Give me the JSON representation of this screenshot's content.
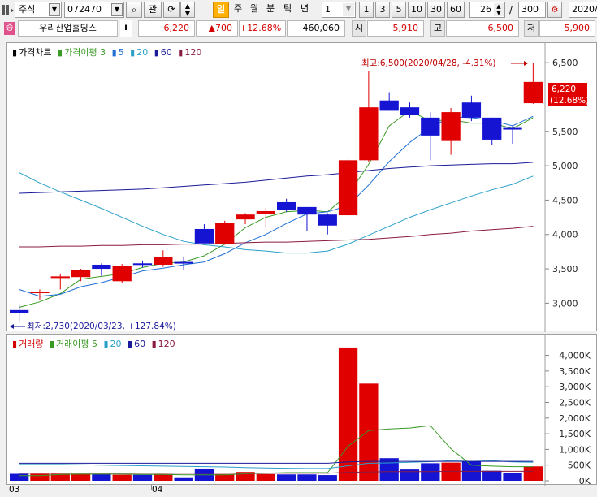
{
  "toolbar": {
    "market": "주식",
    "code": "072470",
    "btn_gwan": "관",
    "btn_il": "일",
    "btn_ju": "주",
    "btn_wol": "월",
    "btn_bun": "분",
    "btn_tik": "틱",
    "btn_nyeon": "년",
    "interval_value": "1",
    "periods": [
      "1",
      "3",
      "5",
      "10",
      "30",
      "60"
    ],
    "count": "26",
    "slash": "/",
    "total": "300",
    "date": "2020/"
  },
  "info": {
    "tag": "증",
    "name": "우리산업홀딩스",
    "i_button": "i",
    "price": "6,220",
    "change": "▲700",
    "change_pct": "+12.68%",
    "volume": "460,060",
    "open_label": "시",
    "open": "5,910",
    "high_label": "고",
    "high": "6,500",
    "low_label": "저",
    "low": "5,900"
  },
  "price_chart": {
    "legend": [
      {
        "text": "가격차트",
        "color": "#000000"
      },
      {
        "text": "가격이평 3",
        "color": "#3a9a24"
      },
      {
        "text": "5",
        "color": "#1e6fd6"
      },
      {
        "text": "20",
        "color": "#2aa0c8"
      },
      {
        "text": "60",
        "color": "#1a1a9a"
      },
      {
        "text": "120",
        "color": "#8a1a40"
      }
    ],
    "y_ticks": [
      "6,500",
      "6,000",
      "5,500",
      "5,000",
      "4,500",
      "4,000",
      "3,500",
      "3,000"
    ],
    "max_annotation": "최고:6,500(2020/04/28, -4.31%)",
    "min_annotation": "최저:2,730(2020/03/23, +127.84%)",
    "current_label_price": "6,220",
    "current_label_pct": "(12.68%)"
  },
  "volume_chart": {
    "legend": [
      {
        "text": "거래량",
        "color": "#d40000"
      },
      {
        "text": "거래이평 5",
        "color": "#3a9a24"
      },
      {
        "text": "20",
        "color": "#2aa0c8"
      },
      {
        "text": "60",
        "color": "#1a1a9a"
      },
      {
        "text": "120",
        "color": "#8a1a40"
      }
    ],
    "y_ticks": [
      "4,000K",
      "3,500K",
      "3,000K",
      "2,500K",
      "2,000K",
      "1,500K",
      "1,000K",
      "500K",
      "0K"
    ]
  },
  "x_axis": {
    "labels": [
      "03",
      "04"
    ]
  },
  "chart_data": {
    "type": "candlestick",
    "y_range": [
      2650,
      6620
    ],
    "volume_range_k": [
      0,
      4300
    ],
    "candles": [
      {
        "o": 2900,
        "h": 2990,
        "l": 2730,
        "c": 2860,
        "v": 220,
        "up": false
      },
      {
        "o": 3150,
        "h": 3200,
        "l": 3050,
        "c": 3170,
        "v": 220,
        "up": true
      },
      {
        "o": 3390,
        "h": 3420,
        "l": 3200,
        "c": 3390,
        "v": 220,
        "up": true
      },
      {
        "o": 3380,
        "h": 3500,
        "l": 3320,
        "c": 3480,
        "v": 220,
        "up": true
      },
      {
        "o": 3560,
        "h": 3580,
        "l": 3400,
        "c": 3500,
        "v": 220,
        "up": false
      },
      {
        "o": 3320,
        "h": 3570,
        "l": 3300,
        "c": 3540,
        "v": 190,
        "up": true
      },
      {
        "o": 3580,
        "h": 3620,
        "l": 3520,
        "c": 3560,
        "v": 190,
        "up": false
      },
      {
        "o": 3560,
        "h": 3770,
        "l": 3530,
        "c": 3670,
        "v": 210,
        "up": true
      },
      {
        "o": 3580,
        "h": 3680,
        "l": 3480,
        "c": 3600,
        "v": 110,
        "up": false
      },
      {
        "o": 4080,
        "h": 4150,
        "l": 3870,
        "c": 3870,
        "v": 390,
        "up": false
      },
      {
        "o": 3860,
        "h": 4200,
        "l": 3850,
        "c": 4170,
        "v": 210,
        "up": true
      },
      {
        "o": 4220,
        "h": 4310,
        "l": 4150,
        "c": 4290,
        "v": 280,
        "up": true
      },
      {
        "o": 4300,
        "h": 4390,
        "l": 4100,
        "c": 4340,
        "v": 210,
        "up": true
      },
      {
        "o": 4470,
        "h": 4520,
        "l": 4330,
        "c": 4360,
        "v": 200,
        "up": false
      },
      {
        "o": 4400,
        "h": 4400,
        "l": 4050,
        "c": 4290,
        "v": 200,
        "up": false
      },
      {
        "o": 4290,
        "h": 4310,
        "l": 4000,
        "c": 4130,
        "v": 180,
        "up": false
      },
      {
        "o": 4280,
        "h": 5100,
        "l": 4270,
        "c": 5080,
        "v": 4250,
        "up": true
      },
      {
        "o": 5080,
        "h": 6380,
        "l": 5060,
        "c": 5850,
        "v": 3100,
        "up": true
      },
      {
        "o": 5950,
        "h": 6070,
        "l": 5830,
        "c": 5800,
        "v": 720,
        "up": false
      },
      {
        "o": 5850,
        "h": 5920,
        "l": 5700,
        "c": 5740,
        "v": 360,
        "up": false
      },
      {
        "o": 5700,
        "h": 5780,
        "l": 5080,
        "c": 5440,
        "v": 560,
        "up": false
      },
      {
        "o": 5360,
        "h": 5840,
        "l": 5160,
        "c": 5780,
        "v": 580,
        "up": true
      },
      {
        "o": 5920,
        "h": 6020,
        "l": 5650,
        "c": 5700,
        "v": 620,
        "up": false
      },
      {
        "o": 5700,
        "h": 5700,
        "l": 5300,
        "c": 5380,
        "v": 320,
        "up": false
      },
      {
        "o": 5550,
        "h": 5580,
        "l": 5320,
        "c": 5540,
        "v": 260,
        "up": false
      },
      {
        "o": 5910,
        "h": 6500,
        "l": 5900,
        "c": 6220,
        "v": 460,
        "up": true
      }
    ],
    "ma": [
      {
        "name": "3",
        "color": "#3a9a24",
        "values": [
          2940,
          3020,
          3140,
          3350,
          3390,
          3430,
          3520,
          3580,
          3600,
          3690,
          3860,
          4100,
          4250,
          4330,
          4350,
          4330,
          4580,
          5020,
          5580,
          5800,
          5650,
          5670,
          5620,
          5620,
          5540,
          5700
        ]
      },
      {
        "name": "5",
        "color": "#1e6fd6",
        "values": [
          3200,
          3100,
          3130,
          3240,
          3300,
          3380,
          3470,
          3510,
          3560,
          3600,
          3720,
          3880,
          4000,
          4160,
          4300,
          4330,
          4420,
          4720,
          5060,
          5340,
          5560,
          5710,
          5700,
          5660,
          5580,
          5720
        ]
      },
      {
        "name": "20",
        "color": "#2aa0c8",
        "values": [
          4900,
          4750,
          4620,
          4500,
          4380,
          4250,
          4120,
          4000,
          3900,
          3850,
          3820,
          3780,
          3760,
          3730,
          3730,
          3760,
          3860,
          3990,
          4120,
          4250,
          4360,
          4460,
          4560,
          4650,
          4730,
          4850
        ]
      },
      {
        "name": "60",
        "color": "#1a1a9a",
        "values": [
          4600,
          4610,
          4620,
          4630,
          4640,
          4650,
          4660,
          4680,
          4700,
          4720,
          4740,
          4760,
          4790,
          4820,
          4850,
          4870,
          4900,
          4930,
          4960,
          4980,
          5000,
          5010,
          5020,
          5030,
          5030,
          5050
        ]
      },
      {
        "name": "120",
        "color": "#8a1a40",
        "values": [
          3820,
          3820,
          3830,
          3830,
          3840,
          3840,
          3850,
          3850,
          3860,
          3860,
          3870,
          3880,
          3890,
          3890,
          3900,
          3910,
          3920,
          3930,
          3950,
          3970,
          4000,
          4020,
          4050,
          4070,
          4090,
          4120
        ]
      }
    ],
    "vol_ma": [
      {
        "name": "5",
        "color": "#3a9a24",
        "values": [
          160,
          160,
          200,
          210,
          210,
          210,
          200,
          200,
          190,
          190,
          190,
          220,
          240,
          260,
          260,
          260,
          1100,
          1600,
          1650,
          1680,
          1760,
          1020,
          500,
          470,
          450,
          450
        ]
      },
      {
        "name": "20",
        "color": "#2aa0c8",
        "values": [
          520,
          520,
          520,
          510,
          500,
          490,
          480,
          470,
          460,
          450,
          440,
          420,
          410,
          400,
          390,
          390,
          480,
          560,
          570,
          590,
          610,
          640,
          660,
          640,
          600,
          590
        ]
      },
      {
        "name": "60",
        "color": "#1a1a9a",
        "values": [
          560,
          560,
          560,
          560,
          560,
          560,
          560,
          560,
          560,
          560,
          560,
          560,
          560,
          560,
          560,
          560,
          600,
          620,
          620,
          620,
          620,
          620,
          620,
          620,
          620,
          620
        ]
      },
      {
        "name": "120",
        "color": "#8a1a40",
        "values": [
          240,
          240,
          240,
          240,
          240,
          240,
          240,
          240,
          240,
          240,
          240,
          240,
          240,
          240,
          240,
          240,
          270,
          280,
          290,
          290,
          290,
          300,
          300,
          300,
          300,
          300
        ]
      }
    ]
  }
}
